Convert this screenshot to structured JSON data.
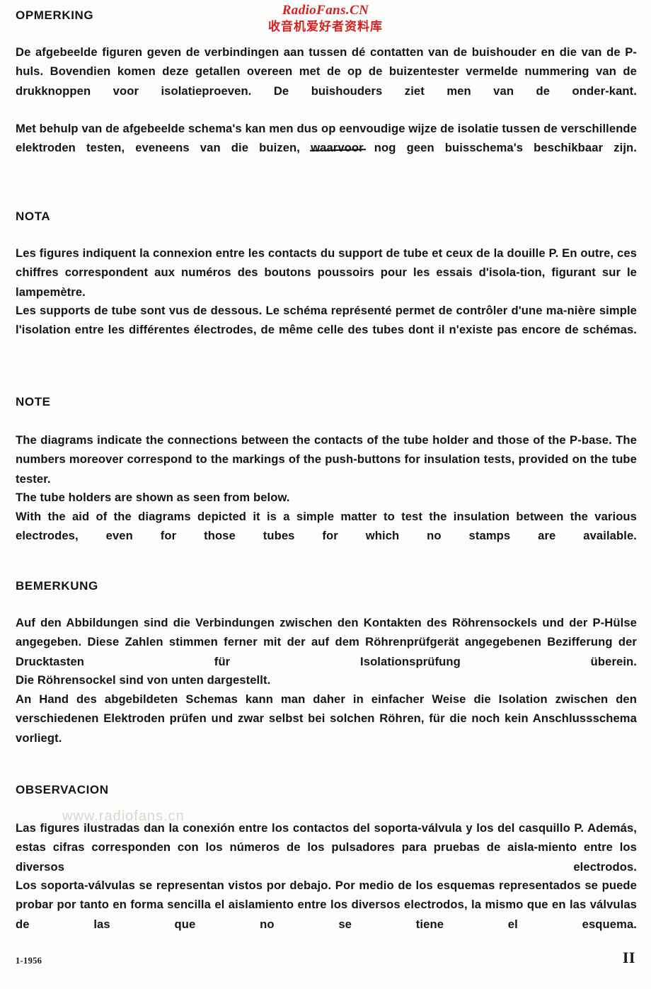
{
  "watermarks": {
    "top_latin": "RadioFans.CN",
    "top_cjk": "收音机爱好者资料库",
    "top_color": "#d81f1f",
    "body_grey": "www.radiofans.cn",
    "body_grey_color": "#d8d8d2"
  },
  "sections": [
    {
      "id": "dutch",
      "heading": "OPMERKING",
      "paragraphs": [
        "De afgebeelde figuren geven de verbindingen aan tussen dé contatten van de buishouder en die van de P-huls. Bovendien komen deze getallen overeen met de op de buizentester vermelde nummering van de drukknoppen voor isolatieproeven. De buishouders ziet men van de onder-kant.",
        "Met behulp van de afgebeelde schema's kan men dus op eenvoudige wijze de isolatie tussen de verschillende elektroden testen, eveneens van die buizen, waarvoor nog geen buisschema's beschikbaar zijn."
      ]
    },
    {
      "id": "french",
      "heading": "NOTA",
      "paragraphs": [
        "Les figures indiquent la connexion entre les contacts du support de tube et ceux de la douille P. En outre, ces chiffres correspondent aux numéros des boutons poussoirs pour les essais d'isola-tion, figurant sur le lampemètre.",
        "Les supports de tube sont vus de dessous. Le schéma représenté permet de contrôler d'une ma-nière simple l'isolation entre les différentes électrodes, de même celle des tubes dont il n'existe pas encore de schémas."
      ]
    },
    {
      "id": "english",
      "heading": "NOTE",
      "paragraphs": [
        "The diagrams indicate the connections between the contacts of the tube holder and those of the P-base. The numbers moreover correspond to the markings of the push-buttons for insulation tests, provided on the tube tester.",
        "The tube holders are shown as seen from below.",
        "With the aid of the diagrams depicted it is a simple matter to test the insulation between the various electrodes, even for those tubes for which no stamps are available."
      ]
    },
    {
      "id": "german",
      "heading": "BEMERKUNG",
      "paragraphs": [
        "Auf den Abbildungen sind die Verbindungen zwischen den Kontakten des Röhrensockels und der P-Hülse angegeben. Diese Zahlen stimmen ferner mit der auf dem Röhrenprüfgerät angegebenen Bezifferung der Drucktasten für Isolationsprüfung überein.",
        "Die Röhrensockel sind von unten dargestellt.",
        "An Hand des abgebildeten Schemas kann man daher in einfacher Weise die Isolation zwischen den verschiedenen Elektroden prüfen und zwar selbst bei solchen Röhren, für die noch kein Anschlussschema vorliegt."
      ]
    },
    {
      "id": "spanish",
      "heading": "OBSERVACION",
      "paragraphs": [
        "Las figures ilustradas dan la conexión entre los contactos del soporta-válvula y los del casquillo P. Además, estas cifras corresponden con los números de los pulsadores para pruebas de aisla-miento entre los diversos electrodos.",
        "Los soporta-válvulas se representan vistos por debajo. Por medio de los esquemas representados se puede probar por tanto en forma sencilla el aislamiento entre los diversos electrodos, la mismo que en las válvulas de las que no se tiene el esquema."
      ]
    }
  ],
  "dutch_line2_parts": {
    "before": "Met behulp van de afgebeelde schema's kan men dus op eenvoudige wijze de isolatie tussen de verschillende elektroden testen, eveneens van die buizen, ",
    "struck": "waarvoor",
    "after": " nog geen buisschema's beschikbaar zijn."
  },
  "footer": {
    "date": "1-1956",
    "page": "II"
  }
}
